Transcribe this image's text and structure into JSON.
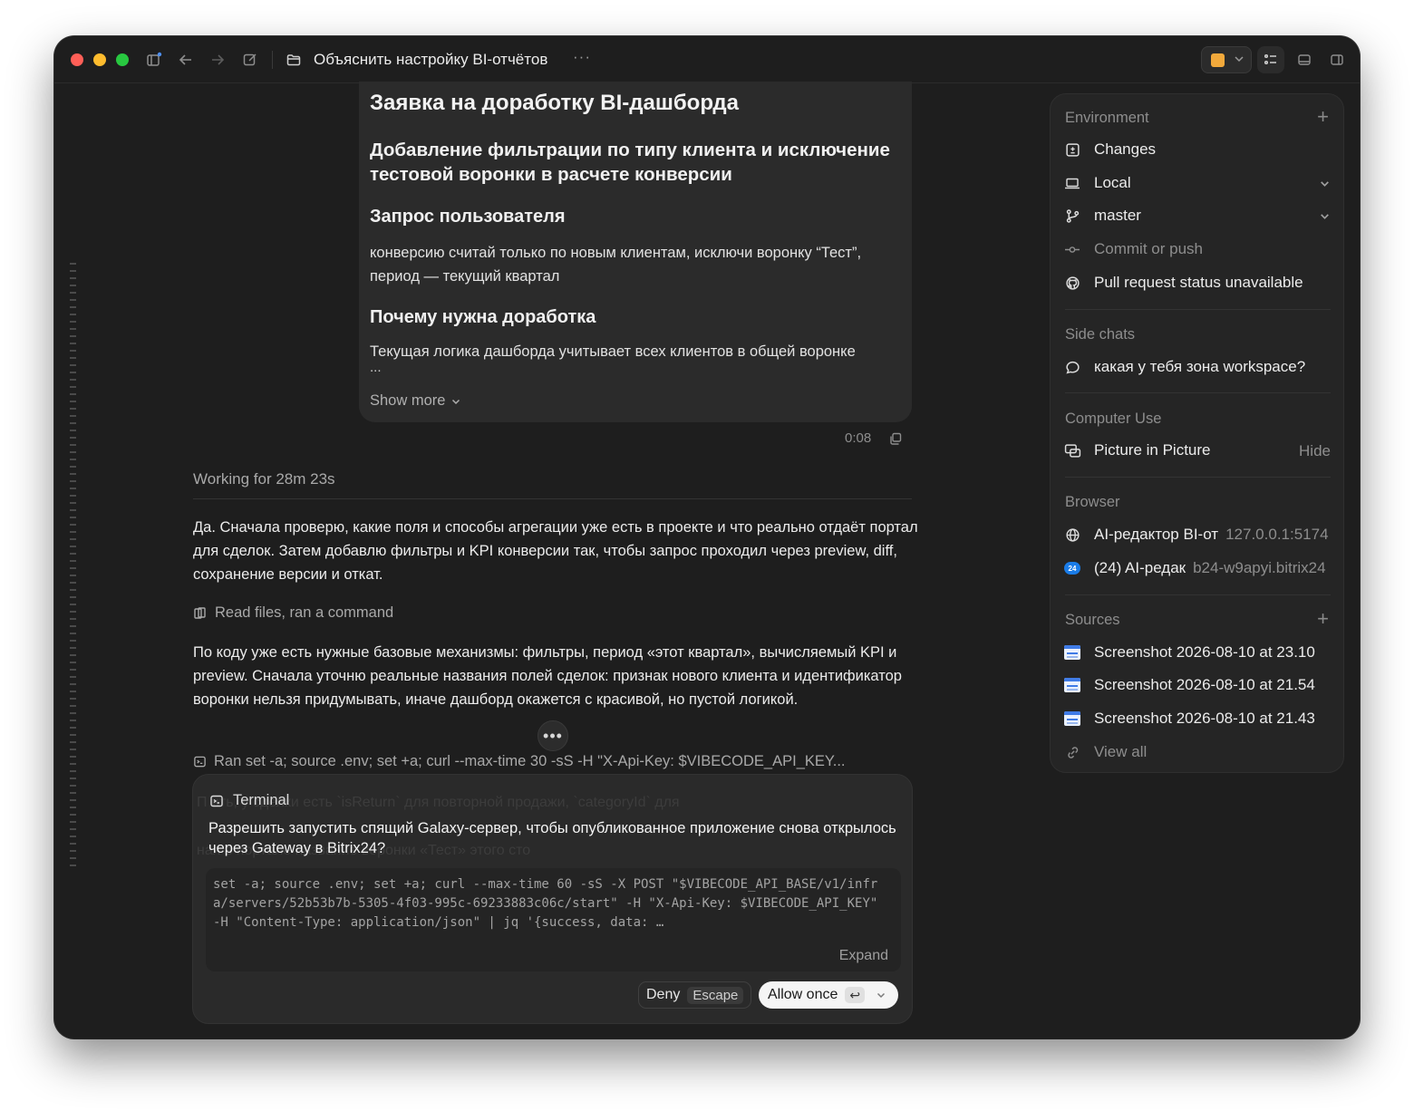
{
  "window": {
    "title": "Объяснить настройку BI-отчётов",
    "title_more": "···"
  },
  "request_card": {
    "heading": "Заявка на доработку BI-дашборда",
    "subheading": "Добавление фильтрации по типу клиента и исключение тестовой воронки в расчете конверсии",
    "user_request_heading": "Запрос пользователя",
    "user_request_text": "конверсию считай только по новым клиентам, исключи воронку “Тест”, период — текущий квартал",
    "why_heading": "Почему нужна доработка",
    "why_text": "Текущая логика дашборда учитывает всех клиентов в общей воронке",
    "why_ellipsis": "...",
    "show_more": "Show more"
  },
  "message_meta": {
    "time": "0:08"
  },
  "working": "Working for 28m 23s",
  "assistant": {
    "para1": "Да. Сначала проверю, какие поля и способы агрегации уже есть в проекте и что реально отдаёт портал для сделок. Затем добавлю фильтры и KPI конверсии так, чтобы запрос проходил через preview, diff, сохранение версии и откат.",
    "tool1": "Read files, ran a command",
    "para2": "По коду уже есть нужные базовые механизмы: фильтры, период «этот квартал», вычисляемый KPI и preview. Сначала уточню реальные названия полей сделок: признак нового клиента и идентификатор воронки нельзя придумывать, иначе дашборд окажется с красивой, но пустой логикой.",
    "dots": "•••",
    "tool2": "Ran set -a; source .env; set +a; curl --max-time 30 -sS -H \"X-Api-Key: $VIBECODE_API_KEY..."
  },
  "terminal": {
    "ghost_line1": "П    ить, у сделки есть `isReturn` для повторной продажи, `categoryId` для",
    "ghost_line2": "                                  ная в портале название воронки «Тест» этого сто",
    "label": "Terminal",
    "question": "Разрешить запустить спящий Galaxy-сервер, чтобы опубликованное приложение снова открылось через Gateway в Bitrix24?",
    "command": "set -a; source .env; set +a; curl --max-time 60 -sS -X POST \"$VIBECODE_API_BASE/v1/infra/servers/52b53b7b-5305-4f03-995c-69233883c06c/start\" -H \"X-Api-Key: $VIBECODE_API_KEY\" -H \"Content-Type: application/json\" | jq '{success, data: …",
    "expand": "Expand",
    "deny_label": "Deny",
    "deny_key": "Escape",
    "allow_label": "Allow once",
    "allow_key": "↩"
  },
  "sidebar": {
    "environment": {
      "title": "Environment",
      "add": "+",
      "items": [
        {
          "label": "Changes"
        },
        {
          "label": "Local"
        },
        {
          "label": "master"
        },
        {
          "label": "Commit or push"
        },
        {
          "label": "Pull request status unavailable"
        }
      ]
    },
    "side_chats": {
      "title": "Side chats",
      "items": [
        {
          "label": "какая у тебя зона workspace?"
        }
      ]
    },
    "computer_use": {
      "title": "Computer Use",
      "item_label": "Picture in Picture",
      "hide": "Hide"
    },
    "browser": {
      "title": "Browser",
      "items": [
        {
          "label": "AI-редактор BI-от",
          "url": "127.0.0.1:5174",
          "icon_text": ""
        },
        {
          "label": "(24) AI-редак",
          "url": "b24-w9apyi.bitrix24",
          "icon_text": "24"
        }
      ]
    },
    "sources": {
      "title": "Sources",
      "add": "+",
      "items": [
        {
          "label": "Screenshot 2026-08-10 at 23.10"
        },
        {
          "label": "Screenshot 2026-08-10 at 21.54"
        },
        {
          "label": "Screenshot 2026-08-10 at 21.43"
        }
      ],
      "view_all": "View all"
    }
  },
  "colors": {
    "accent_yellow": "#f2a93b",
    "traffic_red": "#ff5f57",
    "traffic_yellow": "#febc2e",
    "traffic_green": "#28c840",
    "bitrix_blue": "#1a7ce8"
  }
}
